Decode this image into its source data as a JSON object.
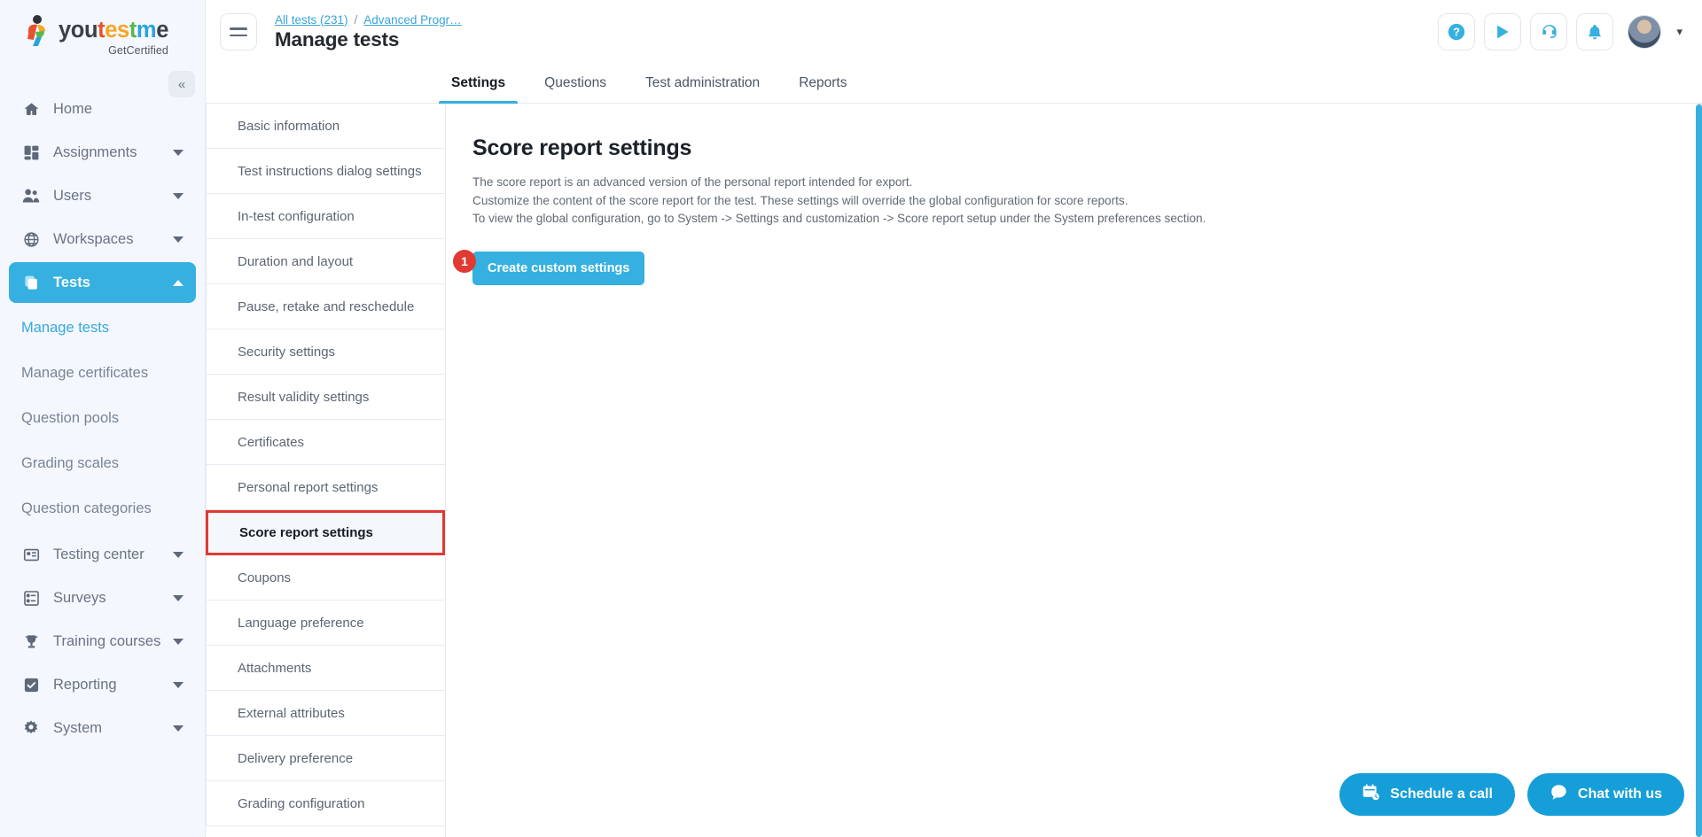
{
  "brand": {
    "name_parts": [
      "you",
      "t",
      "es",
      "t",
      "m",
      "e"
    ],
    "tagline": "GetCertified",
    "accent": "#35b0e0"
  },
  "sidebar": {
    "collapse_icon": "«",
    "items": [
      {
        "label": "Home",
        "icon": "home-icon",
        "expandable": false,
        "active": false
      },
      {
        "label": "Assignments",
        "icon": "assignments-icon",
        "expandable": true,
        "active": false
      },
      {
        "label": "Users",
        "icon": "users-icon",
        "expandable": true,
        "active": false
      },
      {
        "label": "Workspaces",
        "icon": "globe-icon",
        "expandable": true,
        "active": false
      },
      {
        "label": "Tests",
        "icon": "tests-icon",
        "expandable": true,
        "active": true
      }
    ],
    "tests_submenu": [
      {
        "label": "Manage tests",
        "current": true
      },
      {
        "label": "Manage certificates",
        "current": false
      },
      {
        "label": "Question pools",
        "current": false
      },
      {
        "label": "Grading scales",
        "current": false
      },
      {
        "label": "Question categories",
        "current": false
      }
    ],
    "items_bottom": [
      {
        "label": "Testing center",
        "icon": "testing-center-icon",
        "expandable": true
      },
      {
        "label": "Surveys",
        "icon": "surveys-icon",
        "expandable": true
      },
      {
        "label": "Training courses",
        "icon": "trophy-icon",
        "expandable": true
      },
      {
        "label": "Reporting",
        "icon": "reporting-icon",
        "expandable": true
      },
      {
        "label": "System",
        "icon": "gear-icon",
        "expandable": true
      }
    ]
  },
  "header": {
    "menu_toggle": "hamburger-icon",
    "breadcrumb": [
      {
        "label": "All tests (231)",
        "link": true
      },
      {
        "label": "/",
        "link": false
      },
      {
        "label": "Advanced Progr…",
        "link": true
      }
    ],
    "title": "Manage tests",
    "actions": [
      {
        "name": "help-icon",
        "glyph": "?"
      },
      {
        "name": "play-icon",
        "glyph": "▶"
      },
      {
        "name": "support-headset-icon",
        "glyph": "☎"
      },
      {
        "name": "notifications-bell-icon",
        "glyph": "ὑ4"
      }
    ],
    "avatar_chevron": "▾"
  },
  "tabs": [
    {
      "label": "Settings",
      "active": true
    },
    {
      "label": "Questions",
      "active": false
    },
    {
      "label": "Test administration",
      "active": false
    },
    {
      "label": "Reports",
      "active": false
    }
  ],
  "settings_menu": [
    {
      "label": "Basic information",
      "selected": false
    },
    {
      "label": "Test instructions dialog settings",
      "selected": false
    },
    {
      "label": "In-test configuration",
      "selected": false
    },
    {
      "label": "Duration and layout",
      "selected": false
    },
    {
      "label": "Pause, retake and reschedule settings",
      "selected": false
    },
    {
      "label": "Security settings",
      "selected": false
    },
    {
      "label": "Result validity settings",
      "selected": false
    },
    {
      "label": "Certificates",
      "selected": false
    },
    {
      "label": "Personal report settings",
      "selected": false
    },
    {
      "label": "Score report settings",
      "selected": true
    },
    {
      "label": "Coupons",
      "selected": false
    },
    {
      "label": "Language preference",
      "selected": false
    },
    {
      "label": "Attachments",
      "selected": false
    },
    {
      "label": "External attributes",
      "selected": false
    },
    {
      "label": "Delivery preference",
      "selected": false
    },
    {
      "label": "Grading configuration",
      "selected": false
    }
  ],
  "panel": {
    "title": "Score report settings",
    "desc_line1": "The score report is an advanced version of the personal report intended for export.",
    "desc_line2": "Customize the content of the score report for the test. These settings will override the global configuration for score reports.",
    "desc_line3": "To view the global configuration, go to System -> Settings and customization -> Score report setup under the System preferences section.",
    "badge": "1",
    "create_button": "Create custom settings"
  },
  "floating": {
    "schedule_label": "Schedule a call",
    "chat_label": "Chat with us"
  }
}
